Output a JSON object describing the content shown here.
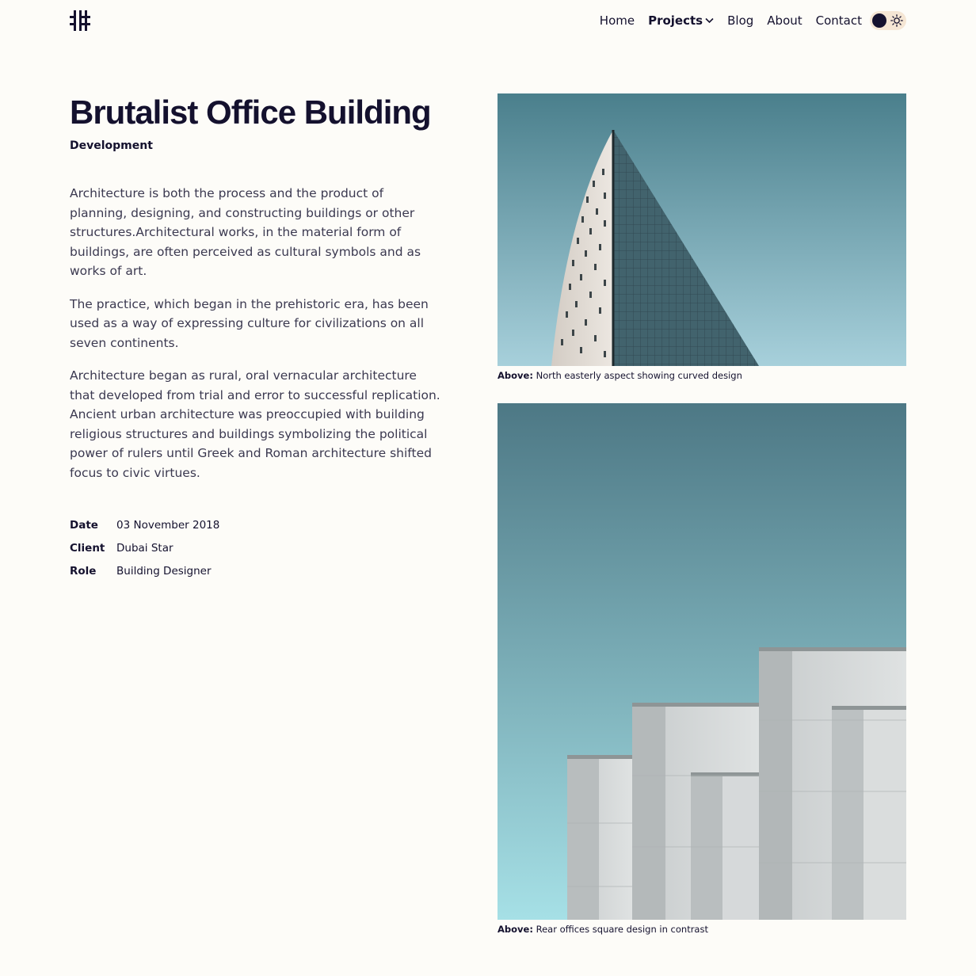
{
  "header": {
    "logo_icon": "hash-grid-logo-icon",
    "nav": [
      {
        "label": "Home"
      },
      {
        "label": "Projects",
        "active": true,
        "has_dropdown": true
      },
      {
        "label": "Blog"
      },
      {
        "label": "About"
      },
      {
        "label": "Contact"
      }
    ],
    "theme_toggle": {
      "state": "dark-selected",
      "icons": [
        "moon-dot-icon",
        "sun-icon"
      ]
    }
  },
  "project": {
    "title": "Brutalist Office Building",
    "category": "Development",
    "paragraphs": [
      "Architecture is both the process and the product of planning, designing, and constructing buildings or other structures.Architectural works, in the material form of buildings, are often perceived as cultural symbols and as works of art.",
      "The practice, which began in the prehistoric era, has been used as a way of expressing culture for civilizations on all seven continents.",
      "Architecture began as rural, oral vernacular architecture that developed from trial and error to successful replication. Ancient urban architecture was preoccupied with building religious structures and buildings symbolizing the political power of rulers until Greek and Roman architecture shifted focus to civic virtues."
    ],
    "meta": [
      {
        "label": "Date",
        "value": "03 November 2018"
      },
      {
        "label": "Client",
        "value": "Dubai Star"
      },
      {
        "label": "Role",
        "value": "Building Designer"
      }
    ]
  },
  "figures": [
    {
      "caption_label": "Above:",
      "caption_text": "North easterly aspect showing curved design"
    },
    {
      "caption_label": "Above:",
      "caption_text": "Rear offices square design in contrast"
    }
  ],
  "colors": {
    "background": "#fdfcf8",
    "text": "#14112e",
    "toggle_bg": "#f5e6d4"
  }
}
